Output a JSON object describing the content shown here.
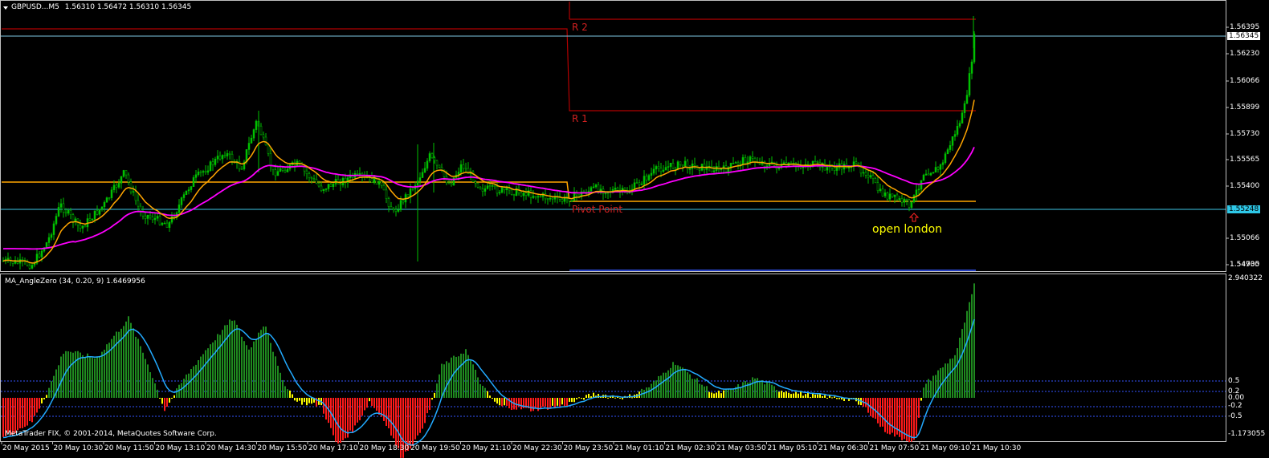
{
  "main_chart": {
    "header": {
      "menu_arrow": "triangle-down-icon",
      "symbol": "GBPUSD...M5",
      "ohlc": "1.56310 1.56472 1.56310 1.56345"
    },
    "price_axis": [
      "1.56395",
      "1.56230",
      "1.56066",
      "1.55899",
      "1.55730",
      "1.55565",
      "1.55400",
      "1.55248",
      "1.55066",
      "1.54900",
      "1.54735"
    ],
    "bid_tag": "1.56345",
    "pivot_tag": "1.55248",
    "levels": {
      "r2": "R 2",
      "r1": "R 1",
      "pivot": "Pivot Point"
    },
    "annotation": {
      "arrow": "hollow-up-arrow-icon",
      "text": "open london"
    }
  },
  "indicator": {
    "title": "MA_AngleZero (34, 0.20, 9) 1.6469956",
    "axis": [
      "2.940322",
      "0.5",
      "0.2",
      "0.00",
      "-0.2",
      "-0.5",
      "-1.173055"
    ],
    "copyright": "MetaTrader FIX, © 2001-2014, MetaQuotes Software Corp."
  },
  "time_axis": [
    "20 May 2015",
    "20 May 10:30",
    "20 May 11:50",
    "20 May 13:10",
    "20 May 14:30",
    "20 May 15:50",
    "20 May 17:10",
    "20 May 18:30",
    "20 May 19:50",
    "20 May 21:10",
    "20 May 22:30",
    "20 May 23:50",
    "21 May 01:10",
    "21 May 02:30",
    "21 May 03:50",
    "21 May 05:10",
    "21 May 06:30",
    "21 May 07:50",
    "21 May 09:10",
    "21 May 10:30"
  ],
  "colors": {
    "background": "#000000",
    "frame": "#c0c0c0",
    "bull_candle": "#00c000",
    "ema_fast": "#ffa500",
    "ema_slow": "#ff00ff",
    "pivot_line": "#ffa500",
    "resistance": "#b00000",
    "bid_line": "#7ec8e3",
    "hist_up": "#1f8a1f",
    "hist_down": "#ff1a1a",
    "hist_flat": "#ffff00",
    "signal": "#22aaff",
    "level_line": "#3355ff",
    "annotation": "#ffff00"
  }
}
